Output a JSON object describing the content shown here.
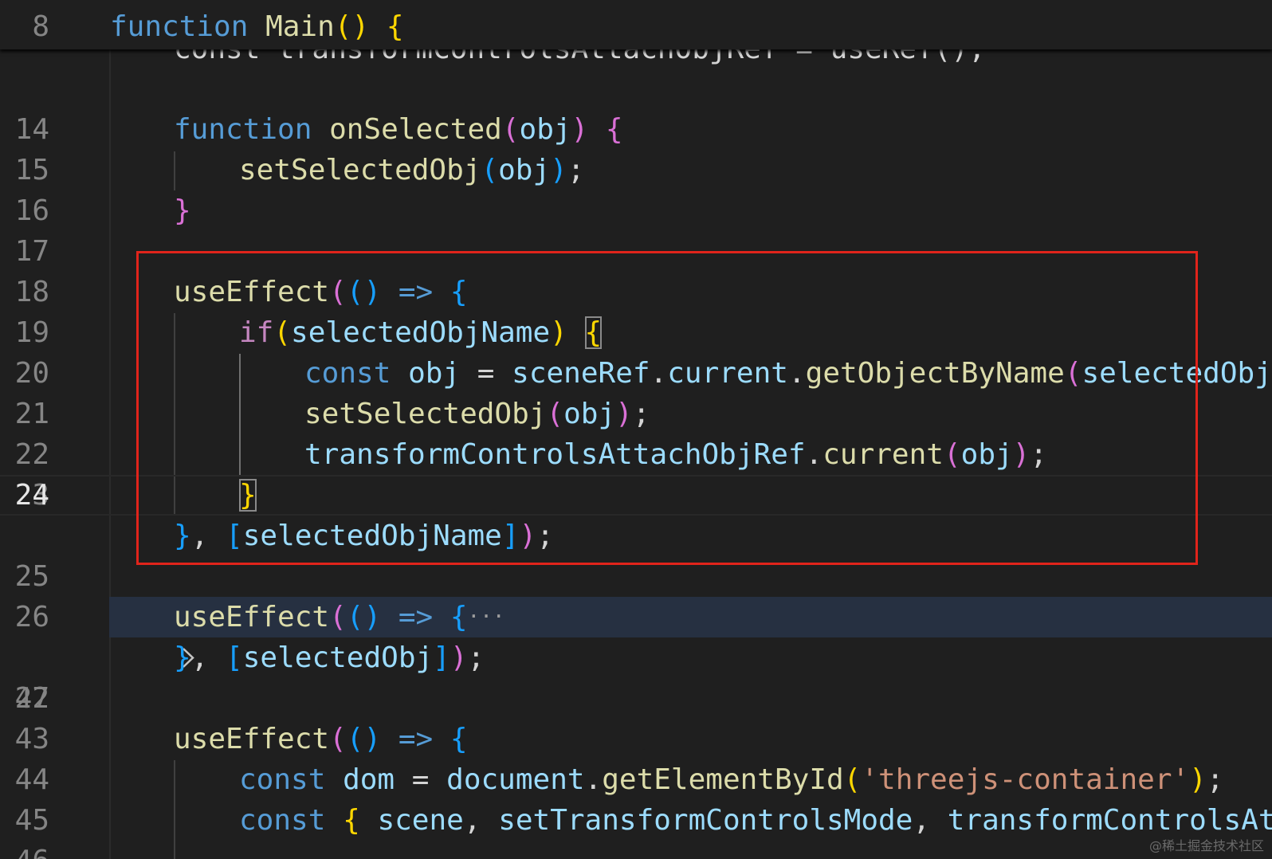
{
  "sticky": {
    "line_number": "8",
    "code": "function Main() {"
  },
  "peek_line": "const transformControlsAttachObjRef = useRef();",
  "lines": [
    {
      "n": "14",
      "text": ""
    },
    {
      "n": "15",
      "text": "function onSelected(obj) {"
    },
    {
      "n": "16",
      "text": "setSelectedObj(obj);"
    },
    {
      "n": "17",
      "text": "}"
    },
    {
      "n": "18",
      "text": ""
    },
    {
      "n": "19",
      "text": "useEffect(() => {"
    },
    {
      "n": "20",
      "text": "if(selectedObjName) {"
    },
    {
      "n": "21",
      "text": "const obj = sceneRef.current.getObjectByName(selectedObjName);"
    },
    {
      "n": "22",
      "text": "setSelectedObj(obj);"
    },
    {
      "n": "23",
      "text": "transformControlsAttachObjRef.current(obj);"
    },
    {
      "n": "24",
      "text": "}"
    },
    {
      "n": "25",
      "text": "}, [selectedObjName]);"
    },
    {
      "n": "26",
      "text": ""
    },
    {
      "n": "27",
      "text": "useEffect(() => {…"
    },
    {
      "n": "42",
      "text": "}, [selectedObj]);"
    },
    {
      "n": "43",
      "text": ""
    },
    {
      "n": "44",
      "text": "useEffect(() => {"
    },
    {
      "n": "45",
      "text": "const dom = document.getElementById('threejs-container');"
    },
    {
      "n": "46",
      "text": "const { scene, setTransformControlsMode, transformControlsAttachObjRef } = useThree();"
    }
  ],
  "active_line": "24",
  "folded_line": "27",
  "icons": {
    "fold": "chevron-right-icon",
    "ellipsis": "fold-ellipsis-icon"
  },
  "colors": {
    "background": "#1f1f1f",
    "annotation_box": "#e0241b",
    "folded_highlight": "#263041"
  },
  "watermark": "@稀土掘金技术社区"
}
